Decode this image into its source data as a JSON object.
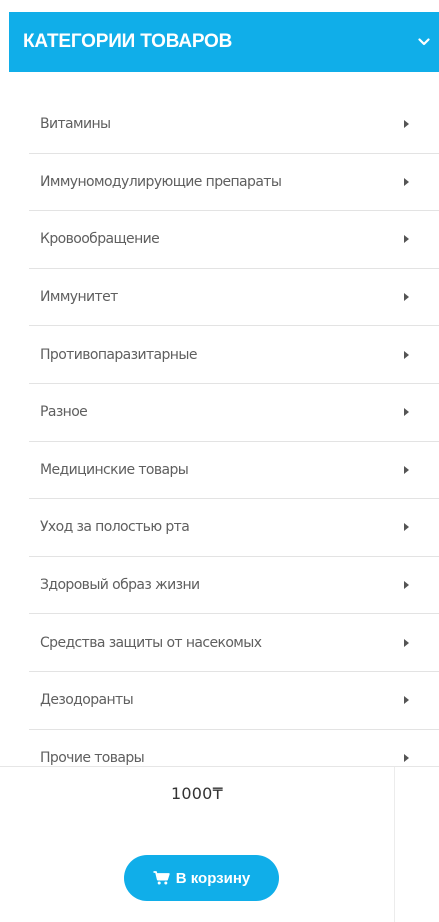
{
  "header": {
    "title": "КАТЕГОРИИ ТОВАРОВ",
    "toggle_icon": "chevron-down-icon",
    "background_color": "#10aee9"
  },
  "menu": {
    "items": [
      {
        "label": "Витамины"
      },
      {
        "label": "Иммуномодулирующие препараты"
      },
      {
        "label": "Кровообращение"
      },
      {
        "label": "Иммунитет"
      },
      {
        "label": "Противопаразитарные"
      },
      {
        "label": "Разное"
      },
      {
        "label": "Медицинские товары"
      },
      {
        "label": "Уход за полостью рта"
      },
      {
        "label": "Здоровый образ жизни"
      },
      {
        "label": "Средства защиты от насекомых"
      },
      {
        "label": "Дезодоранты"
      },
      {
        "label": "Прочие товары"
      }
    ],
    "arrow_icon": "caret-right-icon"
  },
  "product": {
    "price": "1000₸",
    "cart_button_label": "В корзину",
    "cart_icon": "shopping-cart-icon",
    "button_color": "#10aee9"
  }
}
